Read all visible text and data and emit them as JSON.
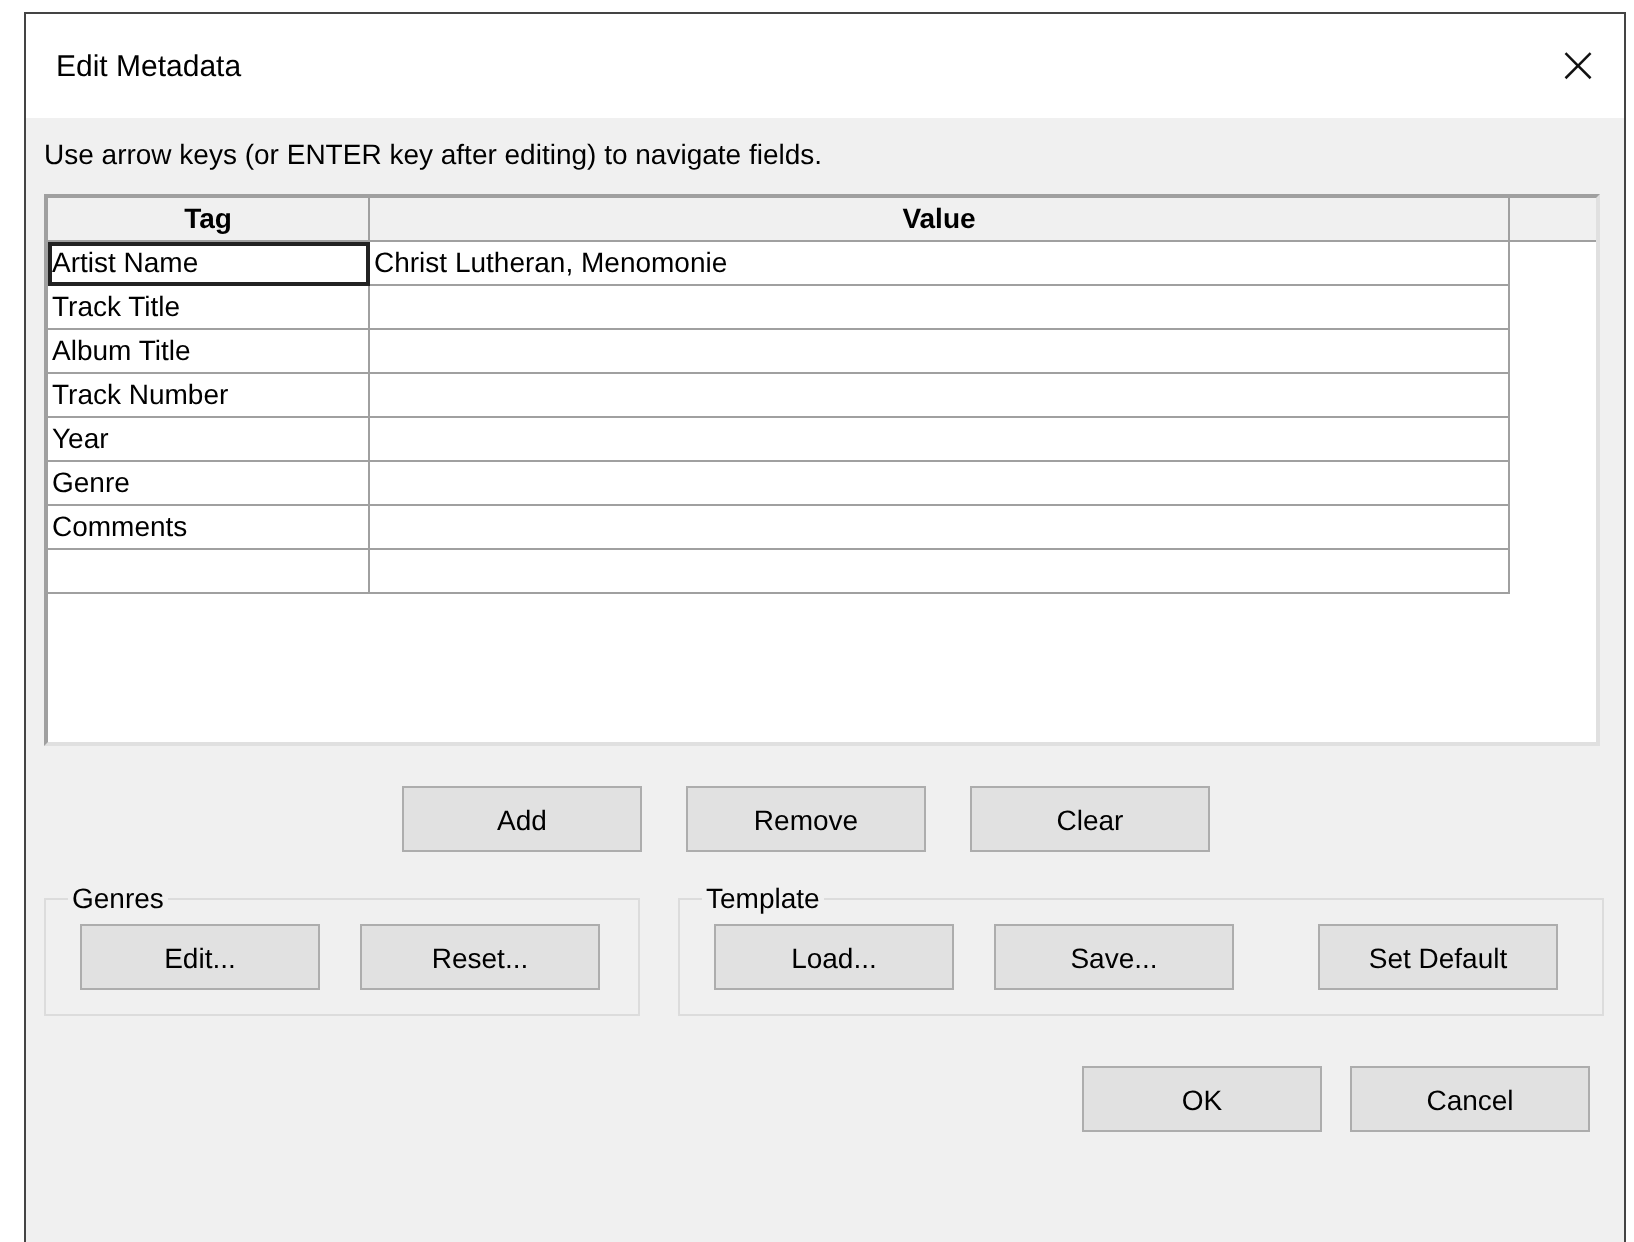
{
  "window": {
    "title": "Edit Metadata",
    "close": "×"
  },
  "instruction": "Use arrow keys (or ENTER key after editing) to navigate fields.",
  "table": {
    "columns": [
      "Tag",
      "Value"
    ],
    "rows": [
      {
        "tag": "Artist Name",
        "value": "Christ Lutheran, Menomonie",
        "selected": true
      },
      {
        "tag": "Track Title",
        "value": "",
        "selected": false
      },
      {
        "tag": "Album Title",
        "value": "",
        "selected": false
      },
      {
        "tag": "Track Number",
        "value": "",
        "selected": false
      },
      {
        "tag": "Year",
        "value": "",
        "selected": false
      },
      {
        "tag": "Genre",
        "value": "",
        "selected": false
      },
      {
        "tag": "Comments",
        "value": "",
        "selected": false
      },
      {
        "tag": "",
        "value": "",
        "selected": false
      }
    ]
  },
  "row_buttons": [
    "Add",
    "Remove",
    "Clear"
  ],
  "groups": [
    {
      "title": "Genres",
      "buttons": [
        "Edit...",
        "Reset..."
      ]
    },
    {
      "title": "Template",
      "buttons": [
        "Load...",
        "Save...",
        "Set Default"
      ]
    }
  ],
  "dialog_buttons": [
    "OK",
    "Cancel"
  ]
}
